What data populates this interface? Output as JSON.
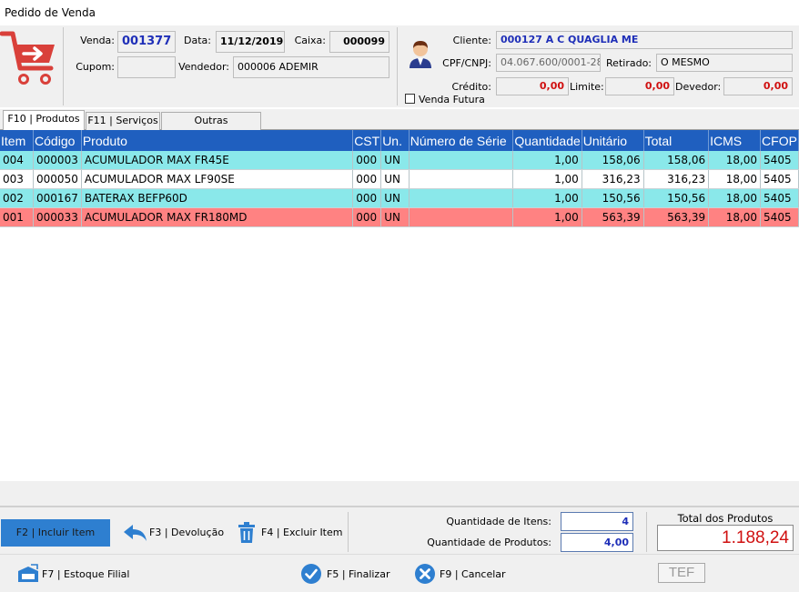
{
  "window": {
    "title": "Pedido de Venda"
  },
  "header": {
    "venda_label": "Venda:",
    "venda": "001377",
    "data_label": "Data:",
    "data": "11/12/2019",
    "caixa_label": "Caixa:",
    "caixa": "000099",
    "cupom_label": "Cupom:",
    "cupom": "",
    "vendedor_label": "Vendedor:",
    "vendedor": "000006  ADEMIR",
    "cliente_label": "Cliente:",
    "cliente": "000127  A C QUAGLIA ME",
    "cpf_label": "CPF/CNPJ:",
    "cpf": "04.067.600/0001-28",
    "retirado_label": "Retirado:",
    "retirado": "O MESMO",
    "credito_label": "Crédito:",
    "credito": "0,00",
    "limite_label": "Limite:",
    "limite": "0,00",
    "devedor_label": "Devedor:",
    "devedor": "0,00",
    "venda_futura_label": "Venda Futura"
  },
  "tabs": [
    {
      "label": "F10 | Produtos"
    },
    {
      "label": "F11 | Serviços"
    },
    {
      "label": "Outras Informações"
    }
  ],
  "table": {
    "columns": [
      "Item",
      "Código",
      "Produto",
      "CST",
      "Un.",
      "Número de Série",
      "Quantidade",
      "Unitário",
      "Total",
      "ICMS",
      "CFOP"
    ],
    "rows": [
      {
        "item": "004",
        "codigo": "000003",
        "produto": "ACUMULADOR MAX FR45E",
        "cst": "000",
        "un": "UN",
        "serie": "",
        "qtd": "1,00",
        "unit": "158,06",
        "total": "158,06",
        "icms": "18,00",
        "cfop": "5405",
        "color": "#8ae8ea"
      },
      {
        "item": "003",
        "codigo": "000050",
        "produto": "ACUMULADOR MAX LF90SE",
        "cst": "000",
        "un": "UN",
        "serie": "",
        "qtd": "1,00",
        "unit": "316,23",
        "total": "316,23",
        "icms": "18,00",
        "cfop": "5405",
        "color": "#ffffff"
      },
      {
        "item": "002",
        "codigo": "000167",
        "produto": "BATERAX BEFP60D",
        "cst": "000",
        "un": "UN",
        "serie": "",
        "qtd": "1,00",
        "unit": "150,56",
        "total": "150,56",
        "icms": "18,00",
        "cfop": "5405",
        "color": "#8ae8ea"
      },
      {
        "item": "001",
        "codigo": "000033",
        "produto": "ACUMULADOR MAX FR180MD",
        "cst": "000",
        "un": "UN",
        "serie": "",
        "qtd": "1,00",
        "unit": "563,39",
        "total": "563,39",
        "icms": "18,00",
        "cfop": "5405",
        "color": "#ff8282"
      }
    ]
  },
  "footer": {
    "incluir": "F2 | Incluir Item",
    "devolucao": "F3 | Devolução",
    "excluir": "F4 | Excluir Item",
    "qtd_itens_label": "Quantidade de Itens:",
    "qtd_itens": "4",
    "qtd_produtos_label": "Quantidade de Produtos:",
    "qtd_produtos": "4,00",
    "total_label": "Total dos Produtos",
    "total": "1.188,24",
    "estoque": "F7 | Estoque Filial",
    "finalizar": "F5 | Finalizar",
    "cancelar": "F9 | Cancelar",
    "tef": "TEF"
  },
  "colors": {
    "header_blue": "#1f5fbf",
    "accent_blue": "#1f2fb8",
    "cart_red": "#d9403a",
    "total_red": "#d01010",
    "button_blue": "#2e7fd0"
  }
}
